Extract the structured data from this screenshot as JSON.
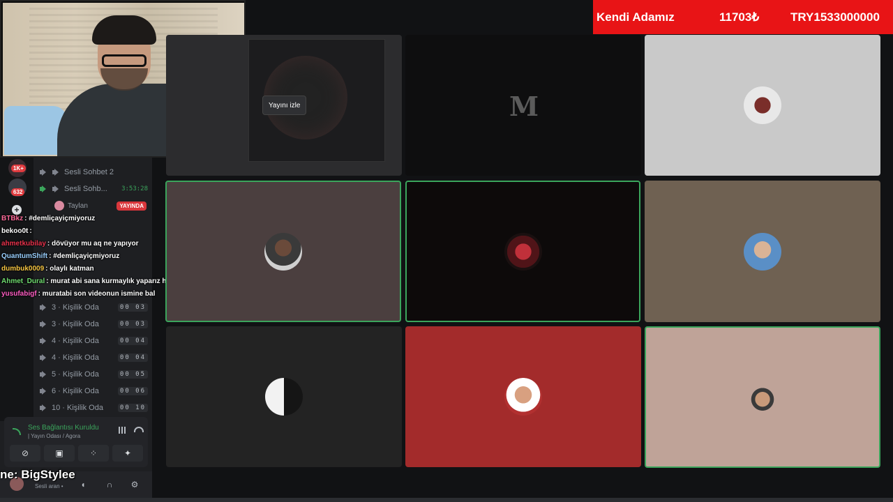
{
  "alert": {
    "name": "Kendi Adamız",
    "amount": "11703₺",
    "goal": "TRY1533000000",
    "color": "#e81416"
  },
  "rail": {
    "badge_1": "1K+",
    "badge_2": "632"
  },
  "channels": [
    {
      "label": "Sesli Sohbet 2",
      "count": "",
      "timer": ""
    },
    {
      "label": "Sesli Sohb...",
      "count": "",
      "timer": "3:53:28"
    },
    {
      "label": "3 · Kişilik Oda",
      "count": "00 03"
    },
    {
      "label": "3 · Kişilik Oda",
      "count": "00 03"
    },
    {
      "label": "4 · Kişilik Oda",
      "count": "00 04"
    },
    {
      "label": "4 · Kişilik Oda",
      "count": "00 04"
    },
    {
      "label": "5 · Kişilik Oda",
      "count": "00 05"
    },
    {
      "label": "6 · Kişilik Oda",
      "count": "00 06"
    },
    {
      "label": "10 · Kişilik Oda",
      "count": "00 10"
    }
  ],
  "user_in_channel": {
    "name": "Taylan",
    "live_label": "YAYINDA"
  },
  "chat": [
    {
      "user": "BTBkz",
      "message": ": #demliçayiçmiyoruz",
      "color": "#ff6b9a"
    },
    {
      "user": "bekoo0t",
      "message": ":",
      "color": "#ffffff"
    },
    {
      "user": "ahmetkubilay",
      "message": ": dövüyor mu aq ne yapıyor",
      "color": "#e8324c"
    },
    {
      "user": "QuantumShift",
      "message": ": #demliçayiçmiyoruz",
      "color": "#9ad0ff"
    },
    {
      "user": "dumbuk0009",
      "message": ": olaylı katman",
      "color": "#f5c542"
    },
    {
      "user": "Ahmet_Dural",
      "message": ": murat abi sana kurmaylık yaparız hemde yusuf abiye",
      "color": "#6fdc6f"
    },
    {
      "user": "yusufabigf",
      "message": ": muratabi son videonun ismine bal",
      "color": "#ff5ec4"
    }
  ],
  "voice": {
    "status": "Ses Bağlantısı Kuruldu",
    "path": "| Yayın Odası / Agora"
  },
  "userbar": {
    "overlay_name": "ne: BigStylee",
    "status": "Sesli aran •"
  },
  "grid": {
    "watch_button": "Yayını izle",
    "m_logo": "M"
  },
  "colors": {
    "speaking": "#3ba55c",
    "live": "#da373c"
  }
}
